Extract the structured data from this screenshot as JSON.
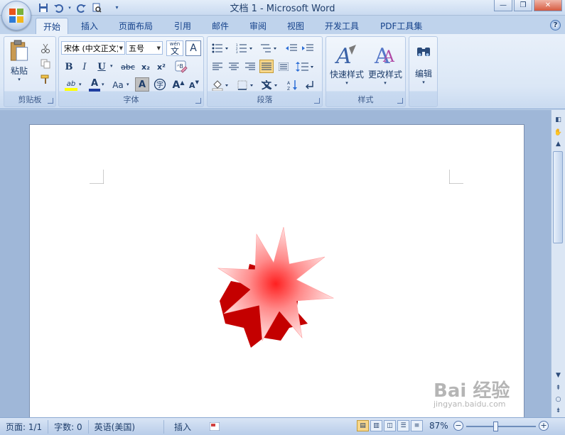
{
  "window": {
    "title": "文档 1 - Microsoft Word"
  },
  "tabs": [
    {
      "label": "开始",
      "active": true
    },
    {
      "label": "插入"
    },
    {
      "label": "页面布局"
    },
    {
      "label": "引用"
    },
    {
      "label": "邮件"
    },
    {
      "label": "审阅"
    },
    {
      "label": "视图"
    },
    {
      "label": "开发工具"
    },
    {
      "label": "PDF工具集"
    }
  ],
  "ribbon": {
    "clipboard": {
      "label": "剪贴板",
      "paste_label": "粘贴"
    },
    "font": {
      "label": "字体",
      "font_name": "宋体 (中文正文)",
      "font_size": "五号",
      "bold": "B",
      "italic": "I",
      "underline": "U",
      "strike": "abc",
      "sub": "x₂",
      "sup": "x²",
      "grow": "A",
      "shrink": "A",
      "case": "Aa",
      "color_a": "A",
      "phonetic": "wén"
    },
    "paragraph": {
      "label": "段落"
    },
    "styles": {
      "label": "样式",
      "quick_styles": "快速样式",
      "change_styles": "更改样式"
    },
    "editing": {
      "label": "编辑",
      "edit": "编辑"
    }
  },
  "status": {
    "page": "页面: 1/1",
    "words": "字数: 0",
    "language": "英语(美国)",
    "mode": "插入",
    "zoom": "87%"
  },
  "watermark": {
    "text": "Bai 经验",
    "url": "jingyan.baidu.com"
  },
  "colors": {
    "star_light": "#ffd0d0",
    "star_center": "#ff2b2b",
    "star_side": "#c00000"
  }
}
